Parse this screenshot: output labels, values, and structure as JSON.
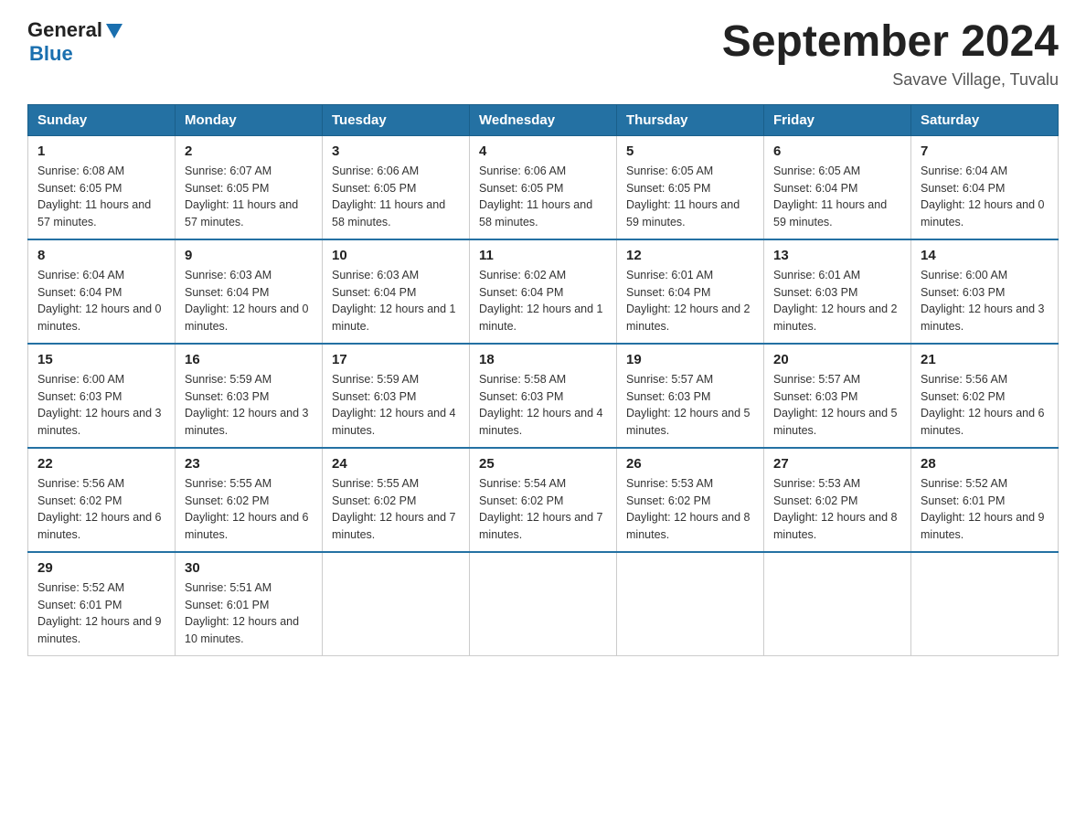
{
  "logo": {
    "text_general": "General",
    "text_blue": "Blue"
  },
  "header": {
    "title": "September 2024",
    "subtitle": "Savave Village, Tuvalu"
  },
  "days_of_week": [
    "Sunday",
    "Monday",
    "Tuesday",
    "Wednesday",
    "Thursday",
    "Friday",
    "Saturday"
  ],
  "weeks": [
    [
      {
        "day": "1",
        "sunrise": "Sunrise: 6:08 AM",
        "sunset": "Sunset: 6:05 PM",
        "daylight": "Daylight: 11 hours and 57 minutes."
      },
      {
        "day": "2",
        "sunrise": "Sunrise: 6:07 AM",
        "sunset": "Sunset: 6:05 PM",
        "daylight": "Daylight: 11 hours and 57 minutes."
      },
      {
        "day": "3",
        "sunrise": "Sunrise: 6:06 AM",
        "sunset": "Sunset: 6:05 PM",
        "daylight": "Daylight: 11 hours and 58 minutes."
      },
      {
        "day": "4",
        "sunrise": "Sunrise: 6:06 AM",
        "sunset": "Sunset: 6:05 PM",
        "daylight": "Daylight: 11 hours and 58 minutes."
      },
      {
        "day": "5",
        "sunrise": "Sunrise: 6:05 AM",
        "sunset": "Sunset: 6:05 PM",
        "daylight": "Daylight: 11 hours and 59 minutes."
      },
      {
        "day": "6",
        "sunrise": "Sunrise: 6:05 AM",
        "sunset": "Sunset: 6:04 PM",
        "daylight": "Daylight: 11 hours and 59 minutes."
      },
      {
        "day": "7",
        "sunrise": "Sunrise: 6:04 AM",
        "sunset": "Sunset: 6:04 PM",
        "daylight": "Daylight: 12 hours and 0 minutes."
      }
    ],
    [
      {
        "day": "8",
        "sunrise": "Sunrise: 6:04 AM",
        "sunset": "Sunset: 6:04 PM",
        "daylight": "Daylight: 12 hours and 0 minutes."
      },
      {
        "day": "9",
        "sunrise": "Sunrise: 6:03 AM",
        "sunset": "Sunset: 6:04 PM",
        "daylight": "Daylight: 12 hours and 0 minutes."
      },
      {
        "day": "10",
        "sunrise": "Sunrise: 6:03 AM",
        "sunset": "Sunset: 6:04 PM",
        "daylight": "Daylight: 12 hours and 1 minute."
      },
      {
        "day": "11",
        "sunrise": "Sunrise: 6:02 AM",
        "sunset": "Sunset: 6:04 PM",
        "daylight": "Daylight: 12 hours and 1 minute."
      },
      {
        "day": "12",
        "sunrise": "Sunrise: 6:01 AM",
        "sunset": "Sunset: 6:04 PM",
        "daylight": "Daylight: 12 hours and 2 minutes."
      },
      {
        "day": "13",
        "sunrise": "Sunrise: 6:01 AM",
        "sunset": "Sunset: 6:03 PM",
        "daylight": "Daylight: 12 hours and 2 minutes."
      },
      {
        "day": "14",
        "sunrise": "Sunrise: 6:00 AM",
        "sunset": "Sunset: 6:03 PM",
        "daylight": "Daylight: 12 hours and 3 minutes."
      }
    ],
    [
      {
        "day": "15",
        "sunrise": "Sunrise: 6:00 AM",
        "sunset": "Sunset: 6:03 PM",
        "daylight": "Daylight: 12 hours and 3 minutes."
      },
      {
        "day": "16",
        "sunrise": "Sunrise: 5:59 AM",
        "sunset": "Sunset: 6:03 PM",
        "daylight": "Daylight: 12 hours and 3 minutes."
      },
      {
        "day": "17",
        "sunrise": "Sunrise: 5:59 AM",
        "sunset": "Sunset: 6:03 PM",
        "daylight": "Daylight: 12 hours and 4 minutes."
      },
      {
        "day": "18",
        "sunrise": "Sunrise: 5:58 AM",
        "sunset": "Sunset: 6:03 PM",
        "daylight": "Daylight: 12 hours and 4 minutes."
      },
      {
        "day": "19",
        "sunrise": "Sunrise: 5:57 AM",
        "sunset": "Sunset: 6:03 PM",
        "daylight": "Daylight: 12 hours and 5 minutes."
      },
      {
        "day": "20",
        "sunrise": "Sunrise: 5:57 AM",
        "sunset": "Sunset: 6:03 PM",
        "daylight": "Daylight: 12 hours and 5 minutes."
      },
      {
        "day": "21",
        "sunrise": "Sunrise: 5:56 AM",
        "sunset": "Sunset: 6:02 PM",
        "daylight": "Daylight: 12 hours and 6 minutes."
      }
    ],
    [
      {
        "day": "22",
        "sunrise": "Sunrise: 5:56 AM",
        "sunset": "Sunset: 6:02 PM",
        "daylight": "Daylight: 12 hours and 6 minutes."
      },
      {
        "day": "23",
        "sunrise": "Sunrise: 5:55 AM",
        "sunset": "Sunset: 6:02 PM",
        "daylight": "Daylight: 12 hours and 6 minutes."
      },
      {
        "day": "24",
        "sunrise": "Sunrise: 5:55 AM",
        "sunset": "Sunset: 6:02 PM",
        "daylight": "Daylight: 12 hours and 7 minutes."
      },
      {
        "day": "25",
        "sunrise": "Sunrise: 5:54 AM",
        "sunset": "Sunset: 6:02 PM",
        "daylight": "Daylight: 12 hours and 7 minutes."
      },
      {
        "day": "26",
        "sunrise": "Sunrise: 5:53 AM",
        "sunset": "Sunset: 6:02 PM",
        "daylight": "Daylight: 12 hours and 8 minutes."
      },
      {
        "day": "27",
        "sunrise": "Sunrise: 5:53 AM",
        "sunset": "Sunset: 6:02 PM",
        "daylight": "Daylight: 12 hours and 8 minutes."
      },
      {
        "day": "28",
        "sunrise": "Sunrise: 5:52 AM",
        "sunset": "Sunset: 6:01 PM",
        "daylight": "Daylight: 12 hours and 9 minutes."
      }
    ],
    [
      {
        "day": "29",
        "sunrise": "Sunrise: 5:52 AM",
        "sunset": "Sunset: 6:01 PM",
        "daylight": "Daylight: 12 hours and 9 minutes."
      },
      {
        "day": "30",
        "sunrise": "Sunrise: 5:51 AM",
        "sunset": "Sunset: 6:01 PM",
        "daylight": "Daylight: 12 hours and 10 minutes."
      },
      null,
      null,
      null,
      null,
      null
    ]
  ]
}
